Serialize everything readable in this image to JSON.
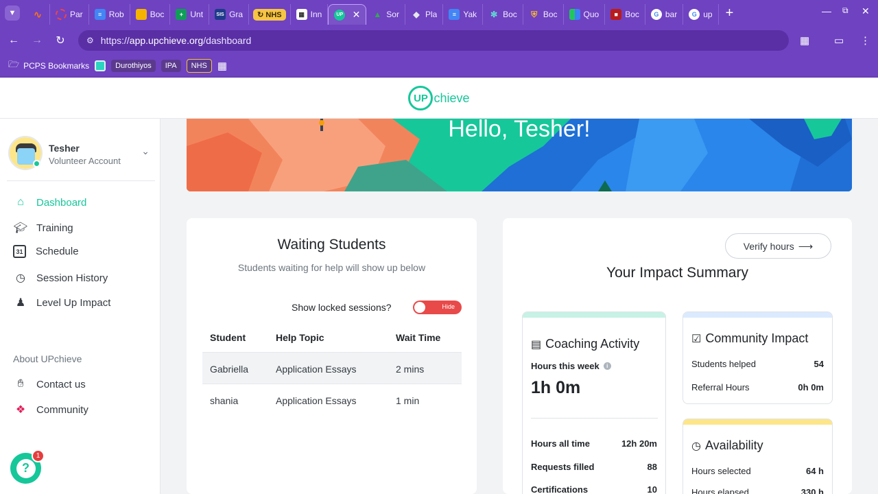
{
  "browser": {
    "tabs": [
      {
        "title": "",
        "icon": "orange-swoosh",
        "color": "#f97316"
      },
      {
        "title": "Par",
        "icon": "red-circle",
        "color": "#ef4444"
      },
      {
        "title": "Rob",
        "icon": "docs-icon",
        "color": "#4285f4"
      },
      {
        "title": "Boc",
        "icon": "slides-icon",
        "color": "#f4b400"
      },
      {
        "title": "Unt",
        "icon": "sheets-icon",
        "color": "#0f9d58"
      },
      {
        "title": "Gra",
        "icon": "sis-icon",
        "color": "#1e3a8a"
      },
      {
        "title": "NHS",
        "icon": "nhs-chip",
        "color": "#f6c545"
      },
      {
        "title": "Inn",
        "icon": "grid-icon",
        "color": "#ffffff"
      },
      {
        "title": "Sor",
        "icon": "drive-icon",
        "color": "#34a853"
      },
      {
        "title": "Pla",
        "icon": "diamond-icon",
        "color": "#e5e7eb"
      },
      {
        "title": "Yak",
        "icon": "docs-icon",
        "color": "#4285f4"
      },
      {
        "title": "Boc",
        "icon": "tree-icon",
        "color": "#5eead4"
      },
      {
        "title": "Boc",
        "icon": "shield-icon",
        "color": "#fbbf24"
      },
      {
        "title": "Quo",
        "icon": "colorgrid-icon",
        "color": "#22c55e"
      },
      {
        "title": "Boc",
        "icon": "book-icon",
        "color": "#b91c1c"
      },
      {
        "title": "bar",
        "icon": "google-icon",
        "color": "#ffffff"
      },
      {
        "title": "up",
        "icon": "google-icon",
        "color": "#ffffff"
      }
    ],
    "active_tab_icon": "UP",
    "url_prefix": "https://",
    "url_domain": "app.upchieve.org",
    "url_path": "/dashboard",
    "bookmarks": {
      "folder": "PCPS Bookmarks",
      "chip1": "Durothiyos",
      "chip2": "IPA",
      "chip3": "NHS"
    }
  },
  "header": {
    "logo_up": "UP",
    "logo_rest": "chieve"
  },
  "sidebar": {
    "user_name": "Tesher",
    "user_role": "Volunteer Account",
    "nav": [
      {
        "label": "Dashboard",
        "icon": "home-icon"
      },
      {
        "label": "Training",
        "icon": "graduation-cap-icon"
      },
      {
        "label": "Schedule",
        "icon": "calendar-icon"
      },
      {
        "label": "Session History",
        "icon": "clock-icon"
      },
      {
        "label": "Level Up Impact",
        "icon": "people-icon"
      }
    ],
    "about_label": "About UPchieve",
    "about_links": [
      {
        "label": "Contact us",
        "icon": "waving-hand-icon"
      },
      {
        "label": "Community",
        "icon": "slack-icon"
      }
    ],
    "help_badge": "1"
  },
  "banner": {
    "greeting": "Hello, Tesher!"
  },
  "waiting_students": {
    "title": "Waiting Students",
    "subtitle": "Students waiting for help will show up below",
    "locked_label": "Show locked sessions?",
    "toggle_label": "Hide",
    "columns": [
      "Student",
      "Help Topic",
      "Wait Time"
    ],
    "rows": [
      {
        "student": "Gabriella",
        "topic": "Application Essays",
        "wait": "2 mins"
      },
      {
        "student": "shania",
        "topic": "Application Essays",
        "wait": "1 min"
      }
    ]
  },
  "impact": {
    "verify_label": "Verify hours",
    "title": "Your Impact Summary",
    "coaching": {
      "title": "Coaching Activity",
      "hours_week_label": "Hours this week",
      "hours_week_value": "1h 0m",
      "stats": [
        {
          "label": "Hours all time",
          "value": "12h 20m"
        },
        {
          "label": "Requests filled",
          "value": "88"
        },
        {
          "label": "Certifications",
          "value": "10"
        }
      ]
    },
    "community": {
      "title": "Community Impact",
      "stats": [
        {
          "label": "Students helped",
          "value": "54"
        },
        {
          "label": "Referral Hours",
          "value": "0h 0m"
        }
      ]
    },
    "availability": {
      "title": "Availability",
      "stats": [
        {
          "label": "Hours selected",
          "value": "64 h"
        },
        {
          "label": "Hours elapsed",
          "value": "330 h"
        }
      ]
    }
  },
  "colors": {
    "brand_green": "#16c79a",
    "browser_purple": "#6f42c1",
    "toggle_red": "#e84a4a"
  }
}
